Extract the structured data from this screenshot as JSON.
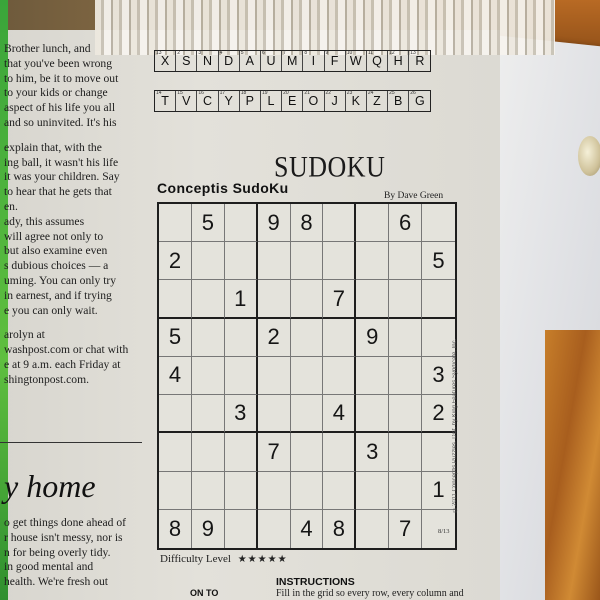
{
  "column_text": {
    "lines_top": [
      "Brother lunch, and",
      "that you've been wrong",
      "to him, be it to move out",
      "to your kids or change",
      "aspect of his life you all",
      "and so uninvited. It's his"
    ],
    "lines_middle": [
      "explain that, with the",
      "ing ball, it wasn't his life",
      "it was your children. Say",
      "to hear that he gets that",
      "en.",
      "ady, this assumes",
      "will agree not only to",
      "but also examine even",
      "s dubious choices — a",
      "uming. You can only try",
      "in earnest, and if trying",
      "e you can only wait."
    ],
    "lines_bottom": [
      "arolyn at",
      "washpost.com or chat with",
      "e at 9 a.m. each Friday at",
      "shingtonpost.com."
    ],
    "headline": "y home",
    "lines_after": [
      "o get things done ahead of",
      "r house isn't messy, nor is",
      "n for being overly tidy.",
      "in good mental and",
      "health. We're fresh out"
    ]
  },
  "cryptogram": {
    "row1": {
      "numbers": [
        "13",
        "2",
        "3",
        "4",
        "5",
        "6",
        "7",
        "8",
        "9",
        "10",
        "11",
        "12",
        "13"
      ],
      "letters": [
        "X",
        "S",
        "N",
        "D",
        "A",
        "U",
        "M",
        "I",
        "F",
        "W",
        "Q",
        "H",
        "R"
      ]
    },
    "row2": {
      "numbers": [
        "14",
        "15",
        "16",
        "17",
        "18",
        "19",
        "20",
        "21",
        "22",
        "23",
        "24",
        "25",
        "26"
      ],
      "letters": [
        "T",
        "V",
        "C",
        "Y",
        "P",
        "L",
        "E",
        "O",
        "J",
        "K",
        "Z",
        "B",
        "G"
      ]
    }
  },
  "sudoku": {
    "title": "SUDOKU",
    "subtitle": "Conceptis SudoKu",
    "byline": "By Dave Green",
    "grid": [
      [
        "",
        "5",
        "",
        "9",
        "8",
        "",
        "",
        "6",
        ""
      ],
      [
        "2",
        "",
        "",
        "",
        "",
        "",
        "",
        "",
        "5"
      ],
      [
        "",
        "",
        "1",
        "",
        "",
        "7",
        "",
        "",
        ""
      ],
      [
        "5",
        "",
        "",
        "2",
        "",
        "",
        "9",
        "",
        ""
      ],
      [
        "4",
        "",
        "",
        "",
        "",
        "",
        "",
        "",
        "3"
      ],
      [
        "",
        "",
        "3",
        "",
        "",
        "4",
        "",
        "",
        "2"
      ],
      [
        "",
        "",
        "",
        "7",
        "",
        "",
        "3",
        "",
        ""
      ],
      [
        "",
        "",
        "",
        "",
        "",
        "",
        "",
        "",
        "1"
      ],
      [
        "8",
        "9",
        "",
        "",
        "4",
        "8",
        "",
        "7",
        ""
      ]
    ],
    "difficulty_label": "Difficulty Level",
    "difficulty_stars": "★★★★★",
    "credit": "©2011 Conceptis Puzzles. Dist. by King Features Syndicate, Inc.",
    "date_tag": "8/13"
  },
  "footer": {
    "continued_tag": "ON TO",
    "instructions_head": "INSTRUCTIONS",
    "instructions_body": "Fill in the grid so every row, every column and"
  }
}
